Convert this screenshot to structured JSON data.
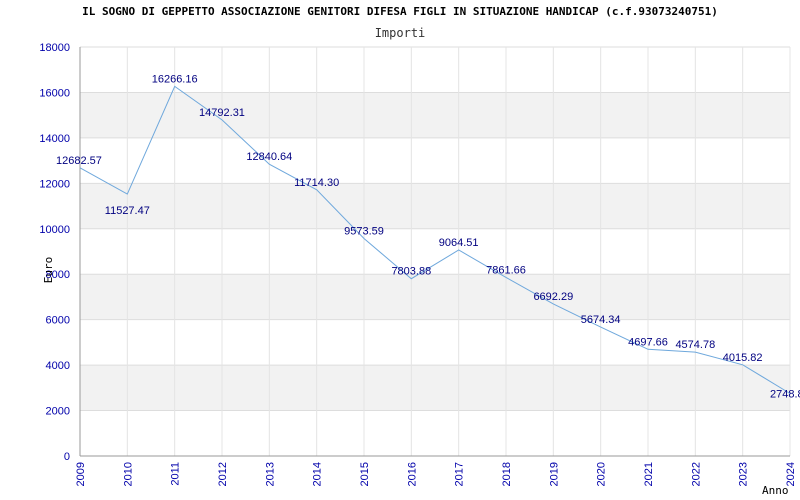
{
  "chart_data": {
    "type": "line",
    "title": "IL SOGNO DI GEPPETTO ASSOCIAZIONE GENITORI DIFESA FIGLI IN SITUAZIONE HANDICAP (c.f.93073240751)",
    "subtitle": "Importi",
    "xlabel": "Anno",
    "ylabel": "Euro",
    "x": [
      "2009",
      "2010",
      "2011",
      "2012",
      "2013",
      "2014",
      "2015",
      "2016",
      "2017",
      "2018",
      "2019",
      "2020",
      "2021",
      "2022",
      "2023",
      "2024"
    ],
    "values": [
      12682.57,
      11527.47,
      16266.16,
      14792.31,
      12840.64,
      11714.3,
      9573.59,
      7803.88,
      9064.51,
      7861.66,
      6692.29,
      5674.34,
      4697.66,
      4574.78,
      4015.82,
      2748.8
    ],
    "value_labels": [
      "12682.57",
      "11527.47",
      "16266.16",
      "14792.31",
      "12840.64",
      "11714.30",
      "9573.59",
      "7803.88",
      "9064.51",
      "7861.66",
      "6692.29",
      "5674.34",
      "4697.66",
      "4574.78",
      "4015.82",
      "2748.8"
    ],
    "y_ticks": [
      0,
      2000,
      4000,
      6000,
      8000,
      10000,
      12000,
      14000,
      16000,
      18000
    ],
    "ylim": [
      0,
      18000
    ],
    "grid": true,
    "line_color": "#6fa8dc",
    "band_color": "#f2f2f2",
    "tick_color": "#0000aa",
    "label_color": "#000080"
  }
}
